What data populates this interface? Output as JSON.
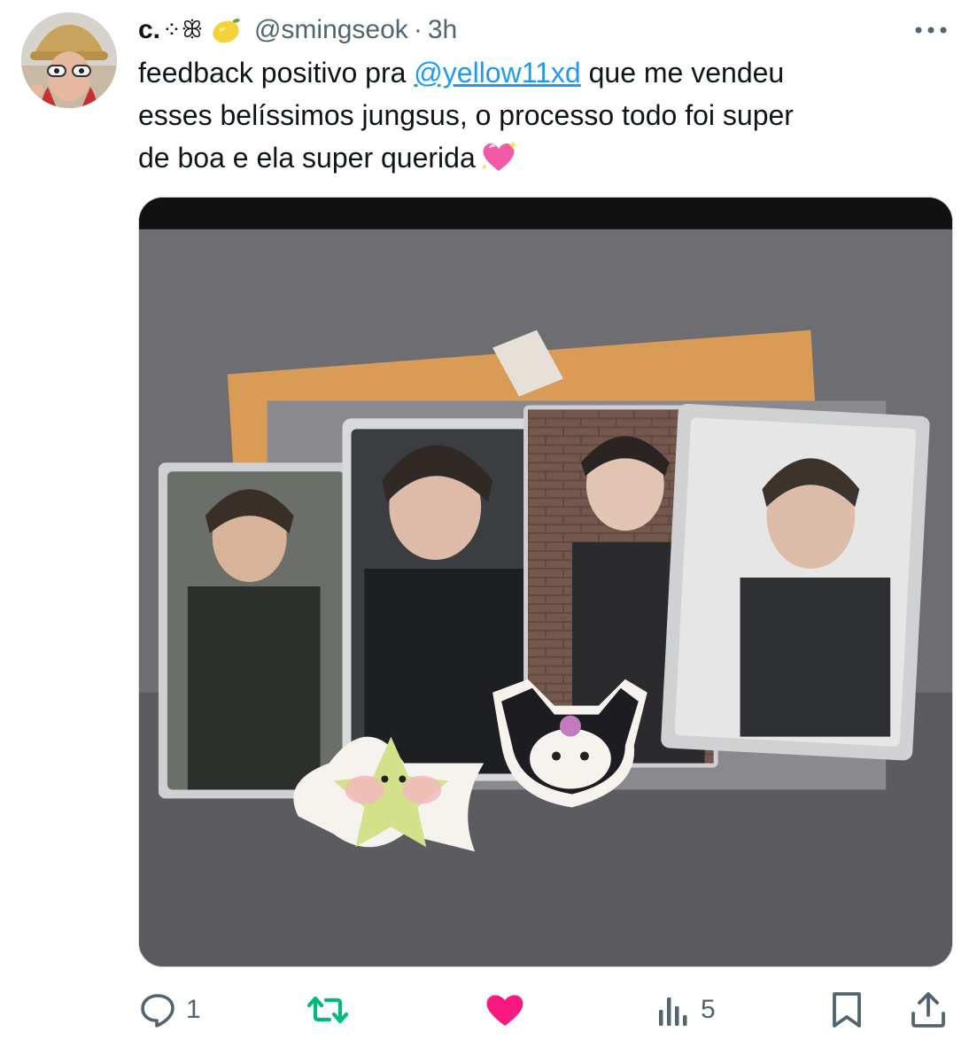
{
  "author": {
    "display_name": "c.",
    "name_decoration": "⁘ꕥ",
    "handle": "@smingseok",
    "separator": "·",
    "time": "3h"
  },
  "tweet": {
    "line1_prefix": "feedback positivo pra ",
    "mention": "@yellow11xd",
    "line1_suffix": " que me vendeu",
    "line2": "esses belíssimos jungsus, o processo todo foi super",
    "line3": "de boa e ela super querida"
  },
  "actions": {
    "reply_count": "1",
    "retweet_count": "",
    "like_count": "",
    "views_count": "5"
  },
  "colors": {
    "text": "#0f1419",
    "secondary": "#536471",
    "link": "#1d9bf0",
    "retweet_active": "#00ba7c",
    "like_active": "#f91880"
  },
  "icons": {
    "more": "more-horizontal-icon",
    "reply": "reply-icon",
    "retweet": "retweet-icon",
    "like": "heart-icon",
    "views": "views-icon",
    "bookmark": "bookmark-icon",
    "share": "share-icon"
  }
}
